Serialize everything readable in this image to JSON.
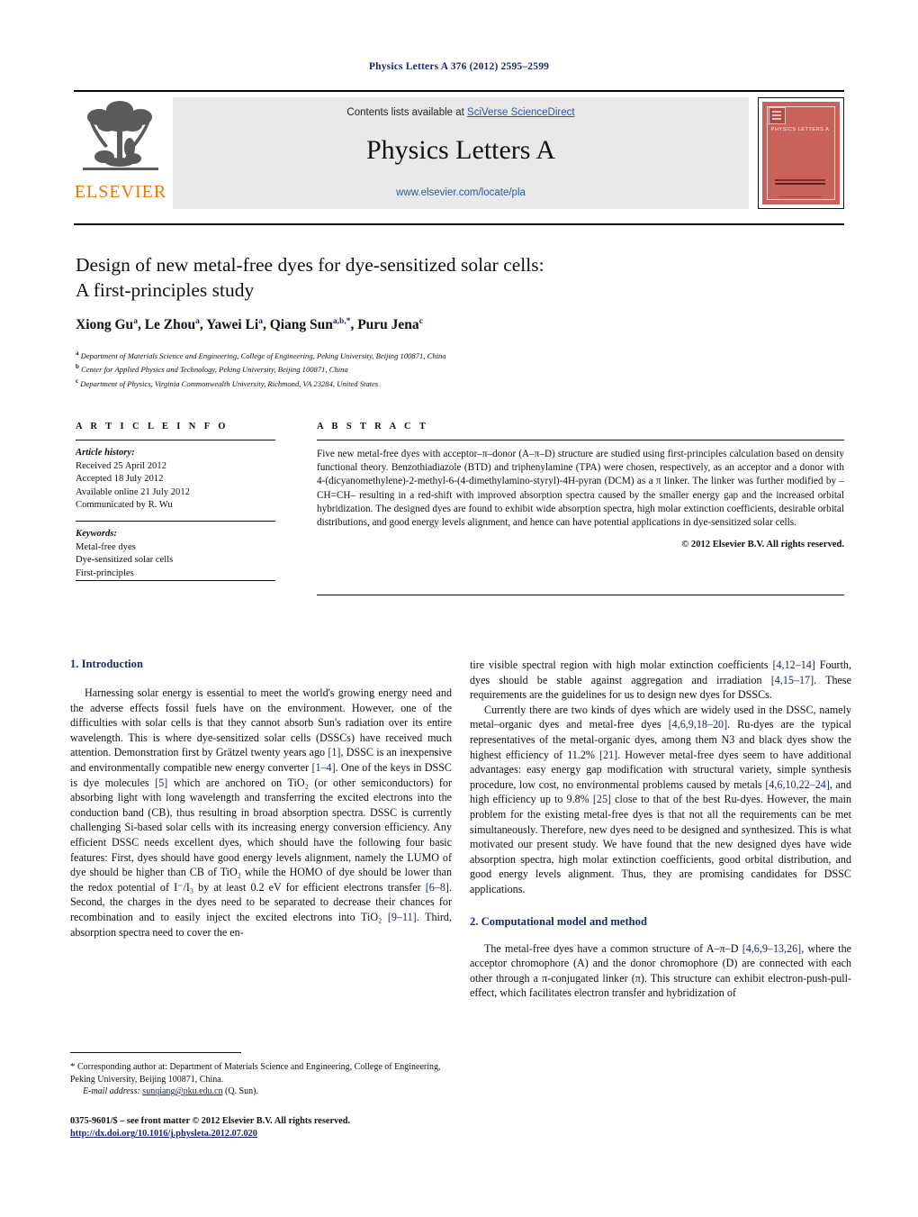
{
  "journal_ref": "Physics Letters A 376 (2012) 2595–2599",
  "masthead": {
    "contents_prefix": "Contents lists available at ",
    "sciencedirect": "SciVerse ScienceDirect",
    "journal_title": "Physics Letters A",
    "journal_url": "www.elsevier.com/locate/pla",
    "publisher_wordmark": "ELSEVIER",
    "cover_title": "PHYSICS LETTERS A",
    "brand_color": "#ec7404",
    "link_color": "#2b57a6",
    "cover_color": "#c9625b"
  },
  "article": {
    "title_line1": "Design of new metal-free dyes for dye-sensitized solar cells:",
    "title_line2": "A first-principles study",
    "authors": [
      {
        "name": "Xiong Gu",
        "marks": "a"
      },
      {
        "name": "Le Zhou",
        "marks": "a"
      },
      {
        "name": "Yawei Li",
        "marks": "a"
      },
      {
        "name": "Qiang Sun",
        "marks": "a,b,*"
      },
      {
        "name": "Puru Jena",
        "marks": "c"
      }
    ],
    "affiliations": [
      {
        "mark": "a",
        "text": "Department of Materials Science and Engineering, College of Engineering, Peking University, Beijing 100871, China"
      },
      {
        "mark": "b",
        "text": "Center for Applied Physics and Technology, Peking University, Beijing 100871, China"
      },
      {
        "mark": "c",
        "text": "Department of Physics, Virginia Commonwealth University, Richmond, VA 23284, United States"
      }
    ]
  },
  "info": {
    "heading": "A R T I C L E   I N F O",
    "history_label": "Article history:",
    "history": [
      "Received 25 April 2012",
      "Accepted 18 July 2012",
      "Available online 21 July 2012",
      "Communicated by R. Wu"
    ],
    "keywords_label": "Keywords:",
    "keywords": [
      "Metal-free dyes",
      "Dye-sensitized solar cells",
      "First-principles"
    ]
  },
  "abstract": {
    "heading": "A B S T R A C T",
    "text": "Five new metal-free dyes with acceptor–π–donor (A–π–D) structure are studied using first-principles calculation based on density functional theory. Benzothiadiazole (BTD) and triphenylamine (TPA) were chosen, respectively, as an acceptor and a donor with 4-(dicyanomethylene)-2-methyl-6-(4-dimethylamino-styryl)-4H-pyran (DCM) as a π linker. The linker was further modified by –CH=CH– resulting in a red-shift with improved absorption spectra caused by the smaller energy gap and the increased orbital hybridization. The designed dyes are found to exhibit wide absorption spectra, high molar extinction coefficients, desirable orbital distributions, and good energy levels alignment, and hence can have potential applications in dye-sensitized solar cells.",
    "copyright": "© 2012 Elsevier B.V. All rights reserved."
  },
  "body": {
    "section1_heading": "1. Introduction",
    "section1_para1_a": "Harnessing solar energy is essential to meet the world's growing energy need and the adverse effects fossil fuels have on the environment. However, one of the difficulties with solar cells is that they cannot absorb Sun's radiation over its entire wavelength. This is where dye-sensitized solar cells (DSSCs) have received much attention. Demonstration first by Grätzel twenty years ago ",
    "ref_1": "[1]",
    "section1_para1_b": ", DSSC is an inexpensive and environmentally compatible new energy converter ",
    "ref_1_4": "[1–4]",
    "section1_para1_c": ". One of the keys in DSSC is dye molecules ",
    "ref_5": "[5]",
    "section1_para1_d": " which are anchored on TiO₂ (or other semiconductors) for absorbing light with long wavelength and transferring the excited electrons into the conduction band (CB), thus resulting in broad absorption spectra. DSSC is currently challenging Si-based solar cells with its increasing energy conversion efficiency. Any efficient DSSC needs excellent dyes, which should have the following four basic features: First, dyes should have good energy levels alignment, namely the LUMO of dye should be higher than CB of TiO₂ while the HOMO of dye should be lower than the redox potential of I⁻/I₃ by at least 0.2 eV for efficient electrons transfer ",
    "ref_6_8": "[6–8]",
    "section1_para1_e": ". Second, the charges in the dyes need to be separated to decrease their chances for recombination and to easily inject the excited electrons into TiO₂ ",
    "ref_9_11": "[9–11]",
    "section1_para1_f": ". Third, absorption spectra need to cover the entire visible spectral region with high molar extinction coefficients ",
    "ref_4_12_14": "[4,12–14]",
    "section1_para1_g": " Fourth, dyes should be stable against aggregation and irradiation ",
    "ref_4_15_17": "[4,15–17]",
    "section1_para1_h": ". These requirements are the guidelines for us to design new dyes for DSSCs.",
    "section1_para2_a": "Currently there are two kinds of dyes which are widely used in the DSSC, namely metal–organic dyes and metal-free dyes ",
    "ref_4_6_9_18_20": "[4,6,9,18–20]",
    "section1_para2_b": ". Ru-dyes are the typical representatives of the metal-organic dyes, among them N3 and black dyes show the highest efficiency of 11.2% ",
    "ref_21": "[21]",
    "section1_para2_c": ". However metal-free dyes seem to have additional advantages: easy energy gap modification with structural variety, simple synthesis procedure, low cost, no environmental problems caused by metals ",
    "ref_4_6_10_22_24": "[4,6,10,22–24]",
    "section1_para2_d": ", and high efficiency up to 9.8% ",
    "ref_25": "[25]",
    "section1_para2_e": " close to that of the best Ru-dyes. However, the main problem for the existing metal-free dyes is that not all the requirements can be met simultaneously. Therefore, new dyes need to be designed and synthesized. This is what motivated our present study. We have found that the new designed dyes have wide absorption spectra, high molar extinction coefficients, good orbital distribution, and good energy levels alignment. Thus, they are promising candidates for DSSC applications.",
    "section2_heading": "2. Computational model and method",
    "section2_para1_a": "The metal-free dyes have a common structure of A–π–D ",
    "ref_4_6_9_13_26": "[4,6,9–13,26]",
    "section2_para1_b": ", where the acceptor chromophore (A) and the donor chromophore (D) are connected with each other through a π-conjugated linker (π). This structure can exhibit electron-push-pull-effect, which facilitates electron transfer and hybridization of"
  },
  "footnotes": {
    "corresponding_star": "*",
    "corresponding_text": "Corresponding author at: Department of Materials Science and Engineering, College of Engineering, Peking University, Beijing 100871, China.",
    "email_label": "E-mail address:",
    "email": "sunqiang@pku.edu.cn",
    "email_suffix": "(Q. Sun).",
    "imprint": "0375-9601/$ – see front matter  © 2012 Elsevier B.V. All rights reserved.",
    "doi": "http://dx.doi.org/10.1016/j.physleta.2012.07.020"
  }
}
